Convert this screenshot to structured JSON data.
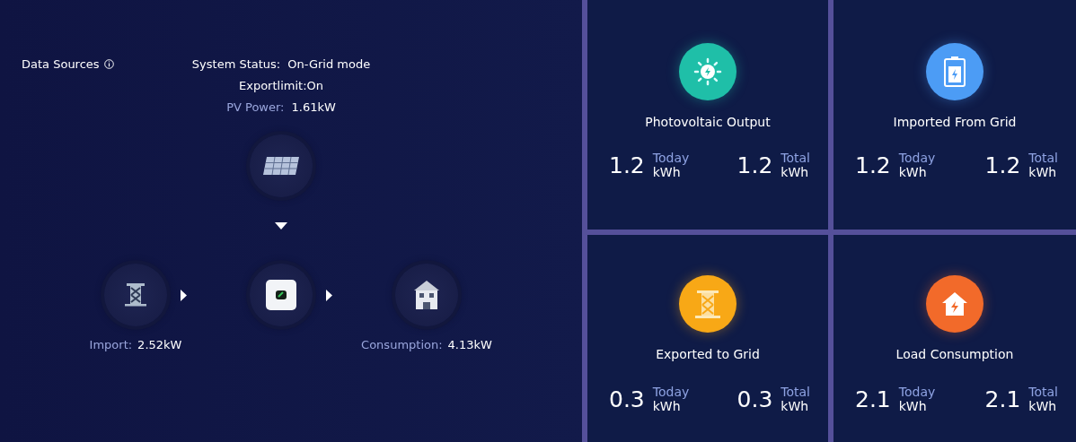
{
  "data_sources": {
    "label": "Data Sources"
  },
  "status": {
    "label": "System Status:",
    "value": "On-Grid mode"
  },
  "export_limit": "Exportlimit:On",
  "pv_power": {
    "label": "PV Power:",
    "value": "1.61kW"
  },
  "flow": {
    "import": {
      "label": "Import:",
      "value": "2.52kW"
    },
    "consumption": {
      "label": "Consumption:",
      "value": "4.13kW"
    }
  },
  "cards": [
    {
      "kind": "sun",
      "color": "#1fbfa8",
      "title": "Photovoltaic Output",
      "today": {
        "value": "1.2",
        "label": "Today",
        "unit": "kWh"
      },
      "total": {
        "value": "1.2",
        "label": "Total",
        "unit": "kWh"
      }
    },
    {
      "kind": "battery",
      "color": "#4c9cf5",
      "title": "Imported From Grid",
      "today": {
        "value": "1.2",
        "label": "Today",
        "unit": "kWh"
      },
      "total": {
        "value": "1.2",
        "label": "Total",
        "unit": "kWh"
      }
    },
    {
      "kind": "tower",
      "color": "#f8a816",
      "title": "Exported to Grid",
      "today": {
        "value": "0.3",
        "label": "Today",
        "unit": "kWh"
      },
      "total": {
        "value": "0.3",
        "label": "Total",
        "unit": "kWh"
      }
    },
    {
      "kind": "house",
      "color": "#f26a2a",
      "title": "Load Consumption",
      "today": {
        "value": "2.1",
        "label": "Today",
        "unit": "kWh"
      },
      "total": {
        "value": "2.1",
        "label": "Total",
        "unit": "kWh"
      }
    }
  ]
}
